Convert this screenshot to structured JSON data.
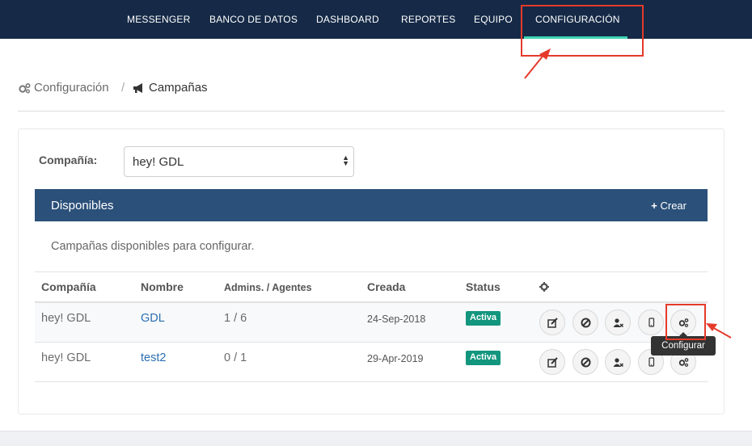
{
  "nav": {
    "items": [
      "MESSENGER",
      "BANCO DE DATOS",
      "DASHBOARD",
      "REPORTES",
      "EQUIPO",
      "CONFIGURACIÓN"
    ],
    "active": "CONFIGURACIÓN",
    "active_color": "#3fd4b4"
  },
  "breadcrumb": {
    "root": "Configuración",
    "separator": "/",
    "current": "Campañas"
  },
  "company": {
    "label": "Compañía:",
    "selected": "hey! GDL"
  },
  "panel": {
    "title": "Disponibles",
    "create_label": "Crear",
    "description": "Campañas disponibles para configurar."
  },
  "table": {
    "headers": [
      "Compañía",
      "Nombre",
      "Admins. / Agentes",
      "Creada",
      "Status"
    ],
    "actions_icon": "gear-icon",
    "rows": [
      {
        "company": "hey! GDL",
        "name": "GDL",
        "admins_agents": "1 / 6",
        "created": "24-Sep-2018",
        "status": "Activa"
      },
      {
        "company": "hey! GDL",
        "name": "test2",
        "admins_agents": "0 / 1",
        "created": "29-Apr-2019",
        "status": "Activa"
      }
    ],
    "row_actions": [
      "edit-icon",
      "block-icon",
      "remove-user-icon",
      "mobile-icon",
      "configure-icon"
    ]
  },
  "tooltip": "Configurar",
  "colors": {
    "nav_bg": "#162a47",
    "panel_header_bg": "#2b5079",
    "status_badge": "#13967e",
    "highlight": "#e53a2b",
    "link": "#2b6fb0"
  }
}
